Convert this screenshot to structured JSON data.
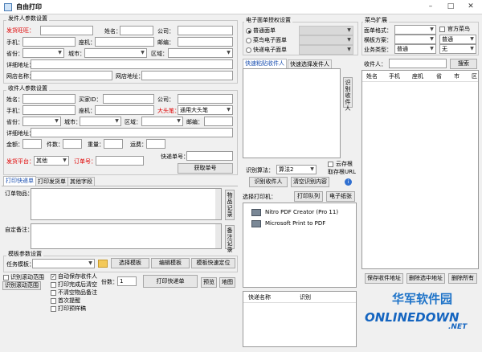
{
  "window": {
    "title": "自由打印",
    "minimize": "–",
    "maximize": "□",
    "close": "✕"
  },
  "sender": {
    "legend": "发件人参数设置",
    "wangwang_label": "发货旺旺：",
    "name_label": "姓名：",
    "company_label": "公司：",
    "phone_label": "手机：",
    "tel_label": "座机：",
    "zip_label": "邮编：",
    "province_label": "省份：",
    "city_label": "城市：",
    "district_label": "区域：",
    "address_label": "详细地址：",
    "shop_label": "网店名称：",
    "url_label": "网店地址："
  },
  "receiver": {
    "legend": "收件人参数设置",
    "name_label": "姓名：",
    "buyer_id_label": "买家ID：",
    "company_label": "公司：",
    "phone_label": "手机：",
    "tel_label": "座机：",
    "bigmark_label": "大头笔：",
    "bigmark_value": "通用大头笔",
    "province_label": "省份：",
    "city_label": "城市：",
    "district_label": "区域：",
    "zip_label": "邮编：",
    "address_label": "详细地址：",
    "amount_label": "金额：",
    "count_label": "件数：",
    "weight_label": "重量：",
    "freight_label": "运费：",
    "platform_label": "发货平台：",
    "platform_value": "其他",
    "order_label": "订单号：",
    "tracking_label": "快递单号：",
    "get_tracking_btn": "获取单号"
  },
  "tabs": [
    "打印快递单",
    "打印发货单",
    "其他字段"
  ],
  "order_goods_label": "订单物品：",
  "goods_record_btn": "物品记录",
  "remark_label": "自定备注：",
  "remark_record_btn": "备注记录",
  "template": {
    "legend": "模板参数设置",
    "task_label": "任务模板：",
    "select_btn": "选择模板",
    "edit_btn": "编辑模板",
    "locate_btn": "模板快速定位"
  },
  "checkboxes": {
    "ocr_select": "识别滚动范围",
    "auto_save": "自动保存收件人",
    "print_clear": "打印完成后清空",
    "no_goods_remark": "不清空物品备注",
    "first_hint": "首次提醒",
    "print_preview": "打印预样稿"
  },
  "ocr_range_btn": "识别滚动范围",
  "copies_label": "份数：",
  "copies_value": "1",
  "print_btn": "打印快递单",
  "preview_btn": "预览",
  "map_btn": "地图",
  "esheet": {
    "legend": "电子面单授权设置",
    "radio_normal": "普通面单",
    "radio_cainiao": "菜鸟电子面单",
    "radio_fast": "快递电子面单"
  },
  "quick_tabs": [
    "快速粘贴收件人",
    "快速选择发件人"
  ],
  "identify_recipient_btn": "识别收件人",
  "algo_label": "识别算法：",
  "algo_value": "算法2",
  "cloud_save": "云存根",
  "take_url": "取存根URL",
  "identify_btn": "识别收件人",
  "clear_btn": "清空识别内容",
  "printer": {
    "label": "选择打印机：",
    "print_queue": "打印队列",
    "sheet_button": "电子纸张",
    "items": [
      "Nitro PDF Creator (Pro 11)",
      "Microsoft Print to PDF"
    ]
  },
  "bottom_table": {
    "cols": [
      "快递名称",
      "识别"
    ]
  },
  "cainiao": {
    "legend": "菜鸟扩展",
    "format_label": "面单格式：",
    "official_label": "官方菜鸟",
    "template_label": "横板方案：",
    "template_value": "普通",
    "type_label": "业务类型：",
    "type_value": "普通",
    "none_value": "无"
  },
  "recipient_search": {
    "label": "收件人：",
    "btn": "搜索"
  },
  "recipient_table": {
    "cols": [
      "姓名",
      "手机",
      "座机",
      "省",
      "市",
      "区"
    ]
  },
  "bottom_buttons": [
    "保存收件地址",
    "删除选中地址",
    "删除所有"
  ],
  "watermark": {
    "cn": "华军软件园",
    "en": "ONLINEDOWN",
    "net": ".NET"
  }
}
